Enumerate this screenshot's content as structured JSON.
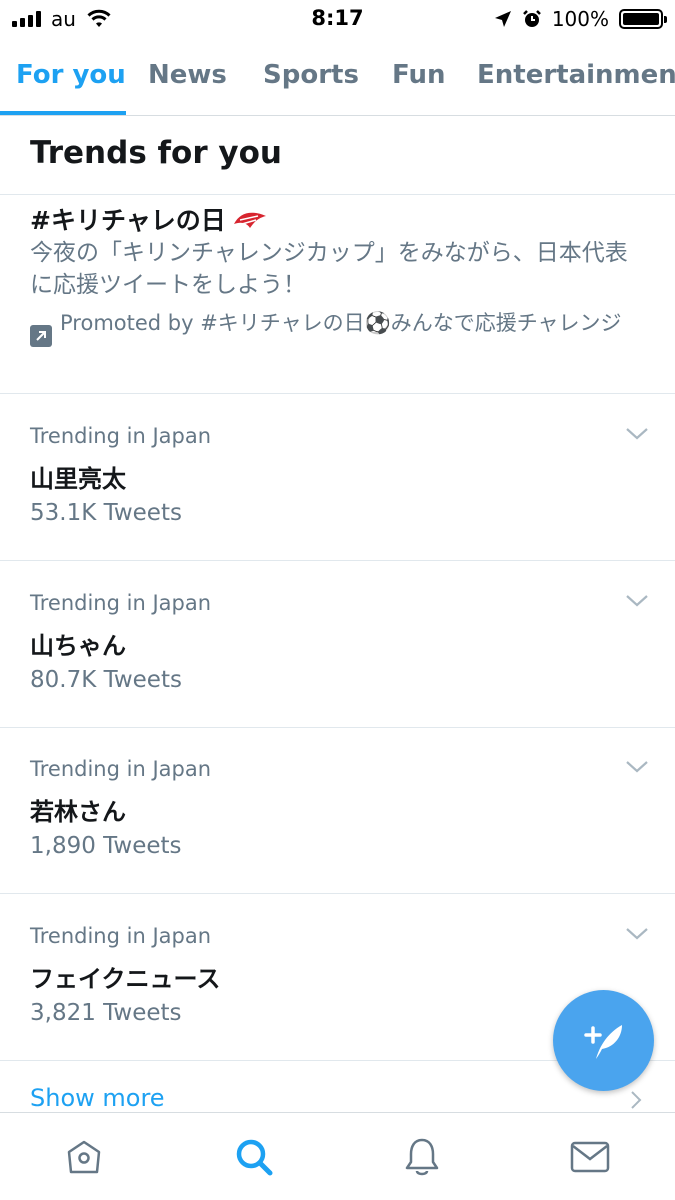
{
  "status_bar": {
    "carrier": "au",
    "time": "8:17",
    "battery": "100%"
  },
  "tabs": [
    {
      "label": "For you",
      "active": true
    },
    {
      "label": "News",
      "active": false
    },
    {
      "label": "Sports",
      "active": false
    },
    {
      "label": "Fun",
      "active": false
    },
    {
      "label": "Entertainment",
      "active": false
    }
  ],
  "section_title": "Trends for you",
  "promoted": {
    "hashtag": "#キリチャレの日",
    "description": "今夜の「キリンチャレンジカップ」をみながら、日本代表に応援ツイートをしよう！",
    "promoted_by": "Promoted by #キリチャレの日⚽みんなで応援チャレンジ"
  },
  "trends": [
    {
      "context": "Trending in Japan",
      "name": "山里亮太",
      "count": "53.1K Tweets"
    },
    {
      "context": "Trending in Japan",
      "name": "山ちゃん",
      "count": "80.7K Tweets"
    },
    {
      "context": "Trending in Japan",
      "name": "若林さん",
      "count": "1,890 Tweets"
    },
    {
      "context": "Trending in Japan",
      "name": "フェイクニュース",
      "count": "3,821 Tweets"
    }
  ],
  "show_more": "Show more",
  "icons": {
    "home": "home-icon",
    "search": "search-icon",
    "notifications": "bell-icon",
    "messages": "mail-icon",
    "compose": "compose-tweet-icon"
  },
  "colors": {
    "accent": "#1da1f2",
    "secondary_text": "#657786",
    "primary_text": "#14171a"
  }
}
